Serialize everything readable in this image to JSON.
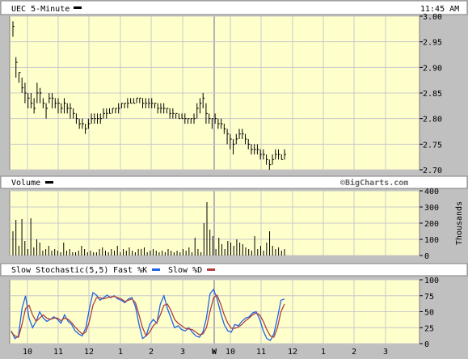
{
  "header": {
    "symbol_title": "UEC 5-Minute",
    "time": "11:45 AM"
  },
  "watermark": "©BigCharts.com",
  "colors": {
    "plot_bg": "#ffffcc",
    "frame_bg": "#c0c0c0",
    "grid": "#c8c8c8",
    "bar": "#000000",
    "fast_k": "#1e64e6",
    "slow_d": "#b04040",
    "day_marker": "#b4b4b4"
  },
  "chart_data": [
    {
      "name": "price",
      "type": "ohlc",
      "ylim": [
        2.7,
        3.0
      ],
      "ytick_labels": [
        "3.00",
        "2.95",
        "2.90",
        "2.85",
        "2.80",
        "2.75",
        "2.70"
      ],
      "ytick_values": [
        3.0,
        2.95,
        2.9,
        2.85,
        2.8,
        2.75,
        2.7
      ],
      "bars": [
        [
          2.99,
          2.98,
          2.96
        ],
        [
          2.92,
          2.91,
          2.88
        ],
        [
          2.89,
          2.89,
          2.87
        ],
        [
          2.88,
          2.86,
          2.85
        ],
        [
          2.87,
          2.85,
          2.83
        ],
        [
          2.85,
          2.84,
          2.82
        ],
        [
          2.85,
          2.83,
          2.82
        ],
        [
          2.84,
          2.82,
          2.81
        ],
        [
          2.87,
          2.85,
          2.83
        ],
        [
          2.86,
          2.85,
          2.83
        ],
        [
          2.84,
          2.83,
          2.82
        ],
        [
          2.83,
          2.82,
          2.8
        ],
        [
          2.85,
          2.84,
          2.83
        ],
        [
          2.85,
          2.84,
          2.82
        ],
        [
          2.84,
          2.83,
          2.82
        ],
        [
          2.84,
          2.83,
          2.81
        ],
        [
          2.83,
          2.82,
          2.81
        ],
        [
          2.84,
          2.83,
          2.81
        ],
        [
          2.83,
          2.82,
          2.81
        ],
        [
          2.83,
          2.82,
          2.8
        ],
        [
          2.82,
          2.81,
          2.8
        ],
        [
          2.81,
          2.8,
          2.79
        ],
        [
          2.8,
          2.79,
          2.78
        ],
        [
          2.8,
          2.79,
          2.78
        ],
        [
          2.79,
          2.78,
          2.77
        ],
        [
          2.8,
          2.79,
          2.78
        ],
        [
          2.81,
          2.8,
          2.79
        ],
        [
          2.81,
          2.8,
          2.79
        ],
        [
          2.81,
          2.8,
          2.79
        ],
        [
          2.81,
          2.8,
          2.79
        ],
        [
          2.82,
          2.81,
          2.8
        ],
        [
          2.82,
          2.81,
          2.8
        ],
        [
          2.82,
          2.81,
          2.81
        ],
        [
          2.82,
          2.82,
          2.81
        ],
        [
          2.82,
          2.82,
          2.81
        ],
        [
          2.83,
          2.82,
          2.81
        ],
        [
          2.83,
          2.83,
          2.82
        ],
        [
          2.83,
          2.83,
          2.82
        ],
        [
          2.84,
          2.83,
          2.82
        ],
        [
          2.84,
          2.83,
          2.83
        ],
        [
          2.84,
          2.83,
          2.83
        ],
        [
          2.84,
          2.84,
          2.83
        ],
        [
          2.84,
          2.84,
          2.83
        ],
        [
          2.84,
          2.83,
          2.82
        ],
        [
          2.84,
          2.83,
          2.82
        ],
        [
          2.84,
          2.83,
          2.82
        ],
        [
          2.84,
          2.83,
          2.82
        ],
        [
          2.83,
          2.83,
          2.82
        ],
        [
          2.83,
          2.82,
          2.81
        ],
        [
          2.83,
          2.82,
          2.81
        ],
        [
          2.83,
          2.82,
          2.81
        ],
        [
          2.82,
          2.82,
          2.81
        ],
        [
          2.82,
          2.81,
          2.8
        ],
        [
          2.82,
          2.81,
          2.8
        ],
        [
          2.81,
          2.81,
          2.8
        ],
        [
          2.81,
          2.8,
          2.8
        ],
        [
          2.81,
          2.8,
          2.8
        ],
        [
          2.81,
          2.8,
          2.79
        ],
        [
          2.8,
          2.8,
          2.79
        ],
        [
          2.8,
          2.8,
          2.79
        ],
        [
          2.81,
          2.8,
          2.79
        ],
        [
          2.83,
          2.82,
          2.8
        ],
        [
          2.84,
          2.83,
          2.81
        ],
        [
          2.85,
          2.84,
          2.82
        ],
        [
          2.83,
          2.81,
          2.79
        ],
        [
          2.81,
          2.8,
          2.79
        ],
        [
          2.8,
          2.8,
          2.78
        ],
        [
          2.81,
          2.8,
          2.79
        ],
        [
          2.8,
          2.79,
          2.78
        ],
        [
          2.8,
          2.79,
          2.78
        ],
        [
          2.79,
          2.78,
          2.77
        ],
        [
          2.78,
          2.77,
          2.75
        ],
        [
          2.77,
          2.76,
          2.74
        ],
        [
          2.76,
          2.75,
          2.73
        ],
        [
          2.77,
          2.76,
          2.75
        ],
        [
          2.78,
          2.77,
          2.76
        ],
        [
          2.78,
          2.77,
          2.76
        ],
        [
          2.77,
          2.76,
          2.75
        ],
        [
          2.76,
          2.75,
          2.74
        ],
        [
          2.75,
          2.74,
          2.73
        ],
        [
          2.75,
          2.74,
          2.73
        ],
        [
          2.75,
          2.74,
          2.73
        ],
        [
          2.74,
          2.73,
          2.72
        ],
        [
          2.74,
          2.73,
          2.72
        ],
        [
          2.73,
          2.72,
          2.71
        ],
        [
          2.72,
          2.71,
          2.7
        ],
        [
          2.73,
          2.72,
          2.71
        ],
        [
          2.74,
          2.73,
          2.72
        ],
        [
          2.74,
          2.73,
          2.72
        ],
        [
          2.73,
          2.72,
          2.72
        ],
        [
          2.74,
          2.73,
          2.72
        ]
      ]
    },
    {
      "name": "volume",
      "type": "bar",
      "title": "Volume",
      "ylabel": "Thousands",
      "ylim": [
        0,
        400
      ],
      "ytick_labels": [
        "400",
        "300",
        "200",
        "100",
        "0"
      ],
      "ytick_values": [
        400,
        300,
        200,
        100,
        0
      ],
      "values": [
        150,
        220,
        60,
        225,
        90,
        40,
        230,
        50,
        100,
        80,
        30,
        40,
        60,
        30,
        40,
        30,
        20,
        80,
        30,
        40,
        20,
        20,
        30,
        60,
        40,
        20,
        30,
        20,
        20,
        40,
        50,
        30,
        20,
        40,
        30,
        60,
        20,
        40,
        30,
        50,
        30,
        20,
        40,
        40,
        50,
        20,
        30,
        40,
        30,
        20,
        30,
        20,
        40,
        30,
        20,
        30,
        20,
        40,
        30,
        50,
        20,
        110,
        40,
        20,
        200,
        330,
        160,
        120,
        40,
        110,
        70,
        40,
        90,
        80,
        60,
        100,
        80,
        70,
        50,
        40,
        30,
        120,
        40,
        60,
        30,
        80,
        150,
        60,
        40,
        50,
        30,
        40
      ]
    },
    {
      "name": "stochastic",
      "type": "line",
      "title": "Slow Stochastic(5,5)",
      "ylim": [
        0,
        100
      ],
      "ytick_labels": [
        "100",
        "75",
        "50",
        "25",
        "0"
      ],
      "ytick_values": [
        100,
        75,
        50,
        25,
        0
      ],
      "series": [
        {
          "name": "Fast %K",
          "values": [
            20,
            8,
            12,
            55,
            75,
            40,
            25,
            35,
            50,
            40,
            35,
            38,
            42,
            38,
            32,
            45,
            35,
            30,
            20,
            15,
            12,
            25,
            55,
            80,
            76,
            68,
            72,
            76,
            72,
            75,
            70,
            68,
            64,
            70,
            72,
            58,
            30,
            8,
            12,
            30,
            38,
            32,
            62,
            75,
            55,
            40,
            25,
            28,
            22,
            20,
            25,
            18,
            12,
            10,
            18,
            40,
            78,
            85,
            70,
            48,
            30,
            20,
            18,
            30,
            28,
            35,
            40,
            42,
            48,
            50,
            38,
            20,
            8,
            5,
            15,
            40,
            68,
            70
          ]
        },
        {
          "name": "Slow %D",
          "values": [
            18,
            12,
            10,
            30,
            55,
            60,
            45,
            35,
            40,
            45,
            40,
            38,
            40,
            40,
            36,
            40,
            38,
            33,
            26,
            20,
            15,
            18,
            35,
            60,
            72,
            72,
            70,
            72,
            73,
            74,
            72,
            70,
            66,
            68,
            70,
            64,
            45,
            25,
            12,
            18,
            28,
            33,
            45,
            60,
            62,
            52,
            38,
            32,
            28,
            24,
            23,
            22,
            18,
            14,
            15,
            25,
            50,
            72,
            76,
            62,
            45,
            32,
            24,
            24,
            26,
            30,
            36,
            40,
            45,
            48,
            45,
            35,
            22,
            12,
            10,
            25,
            50,
            62
          ]
        }
      ]
    },
    {
      "name": "time_axis",
      "type": "axis",
      "tick_labels": [
        "10",
        "11",
        "12",
        "1",
        "2",
        "3",
        "W",
        "10",
        "11",
        "12",
        "1",
        "2",
        "3"
      ],
      "day_separator_label": "W"
    }
  ]
}
